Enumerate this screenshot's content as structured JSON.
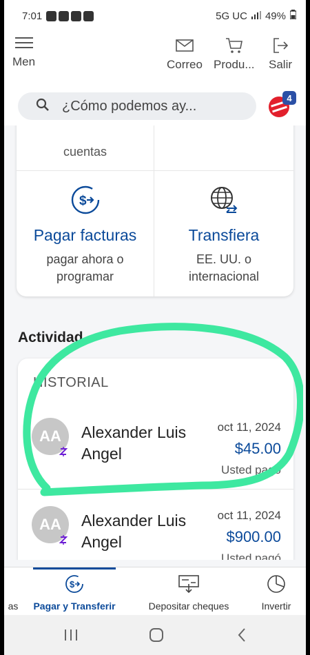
{
  "status_bar": {
    "time": "7:01",
    "network": "5G UC",
    "battery": "49%"
  },
  "header": {
    "menu_label": "Men",
    "actions": [
      {
        "label": "Correo",
        "icon": "mail-icon"
      },
      {
        "label": "Produ...",
        "icon": "cart-icon"
      },
      {
        "label": "Salir",
        "icon": "logout-icon"
      }
    ]
  },
  "search": {
    "placeholder": "¿Cómo podemos ay..."
  },
  "chat": {
    "badge_count": "4"
  },
  "actions_grid": {
    "top_left_partial": "cuentas",
    "pay_bills": {
      "title": "Pagar facturas",
      "subtitle_line1": "pagar ahora o",
      "subtitle_line2": "programar"
    },
    "transfer": {
      "title": "Transfiera",
      "subtitle_line1": "EE. UU. o",
      "subtitle_line2": "internacional"
    }
  },
  "activity": {
    "title": "Actividad",
    "history_label": "HISTORIAL",
    "transactions": [
      {
        "initials": "AA",
        "name": "Alexander Luis Angel",
        "date": "oct 11, 2024",
        "amount": "$45.00",
        "status": "Usted pagó"
      },
      {
        "initials": "AA",
        "name": "Alexander Luis Angel",
        "date": "oct 11, 2024",
        "amount": "$900.00",
        "status": "Usted pagó"
      }
    ]
  },
  "bottom_nav": {
    "items": [
      {
        "label": "as"
      },
      {
        "label": "Pagar y Transferir"
      },
      {
        "label": "Depositar cheques"
      },
      {
        "label": "Invertir"
      }
    ]
  },
  "colors": {
    "brand_blue": "#0b4a9a",
    "highlight_green": "#3ee8a0",
    "zelle_purple": "#6d1ed4"
  }
}
